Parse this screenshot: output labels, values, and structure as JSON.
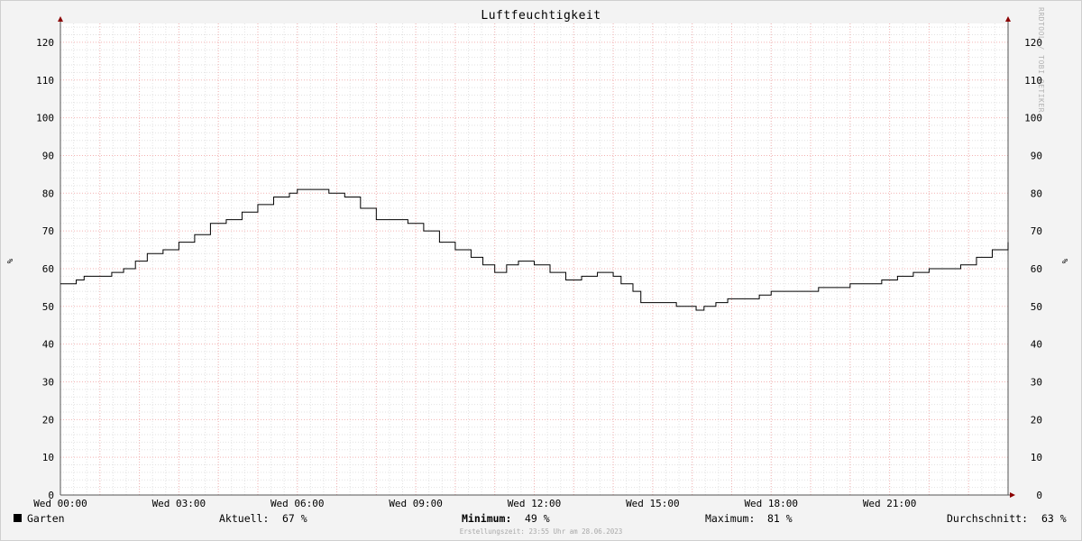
{
  "chart_data": {
    "type": "line",
    "title": "Luftfeuchtigkeit",
    "ylabel": "%",
    "ylim": [
      0,
      125
    ],
    "yticks": [
      0,
      10,
      20,
      30,
      40,
      50,
      60,
      70,
      80,
      90,
      100,
      110,
      120
    ],
    "xlim": [
      0,
      24
    ],
    "xticks": [
      {
        "x": 0,
        "label": "Wed 00:00"
      },
      {
        "x": 3,
        "label": "Wed 03:00"
      },
      {
        "x": 6,
        "label": "Wed 06:00"
      },
      {
        "x": 9,
        "label": "Wed 09:00"
      },
      {
        "x": 12,
        "label": "Wed 12:00"
      },
      {
        "x": 15,
        "label": "Wed 15:00"
      },
      {
        "x": 18,
        "label": "Wed 18:00"
      },
      {
        "x": 21,
        "label": "Wed 21:00"
      }
    ],
    "grid": true,
    "series": [
      {
        "name": "Garten",
        "color": "#000000",
        "x": [
          0,
          0.2,
          0.4,
          0.6,
          1.0,
          1.3,
          1.6,
          1.9,
          2.2,
          2.6,
          3.0,
          3.4,
          3.8,
          4.2,
          4.6,
          5.0,
          5.4,
          5.8,
          6.0,
          6.4,
          6.8,
          7.2,
          7.6,
          8.0,
          8.4,
          8.8,
          9.2,
          9.6,
          10.0,
          10.4,
          10.7,
          11.0,
          11.3,
          11.6,
          12.0,
          12.4,
          12.8,
          13.2,
          13.6,
          14.0,
          14.2,
          14.5,
          14.7,
          14.9,
          15.3,
          15.6,
          15.9,
          16.1,
          16.3,
          16.6,
          16.9,
          17.3,
          17.7,
          18.0,
          18.4,
          18.8,
          19.2,
          19.6,
          20.0,
          20.4,
          20.8,
          21.2,
          21.6,
          22.0,
          22.4,
          22.8,
          23.2,
          23.6,
          24.0
        ],
        "values": [
          56,
          56,
          57,
          58,
          58,
          59,
          60,
          62,
          64,
          65,
          67,
          69,
          72,
          73,
          75,
          77,
          79,
          80,
          81,
          81,
          80,
          79,
          76,
          73,
          73,
          72,
          70,
          67,
          65,
          63,
          61,
          59,
          61,
          62,
          61,
          59,
          57,
          58,
          59,
          58,
          56,
          54,
          51,
          51,
          51,
          50,
          50,
          49,
          50,
          51,
          52,
          52,
          53,
          54,
          54,
          54,
          55,
          55,
          56,
          56,
          57,
          58,
          59,
          60,
          60,
          61,
          63,
          65,
          67
        ]
      }
    ],
    "legend": {
      "series_name": "Garten",
      "aktuell_label": "Aktuell:",
      "aktuell_value": "67 %",
      "minimum_label": "Minimum:",
      "minimum_value": "49 %",
      "maximum_label": "Maximum:",
      "maximum_value": "81 %",
      "avg_label": "Durchschnitt:",
      "avg_value": "63 %"
    },
    "footer": "Erstellungszeit: 23:55 Uhr am 28.06.2023",
    "watermark": "RRDTOOL / TOBI OETIKER"
  }
}
